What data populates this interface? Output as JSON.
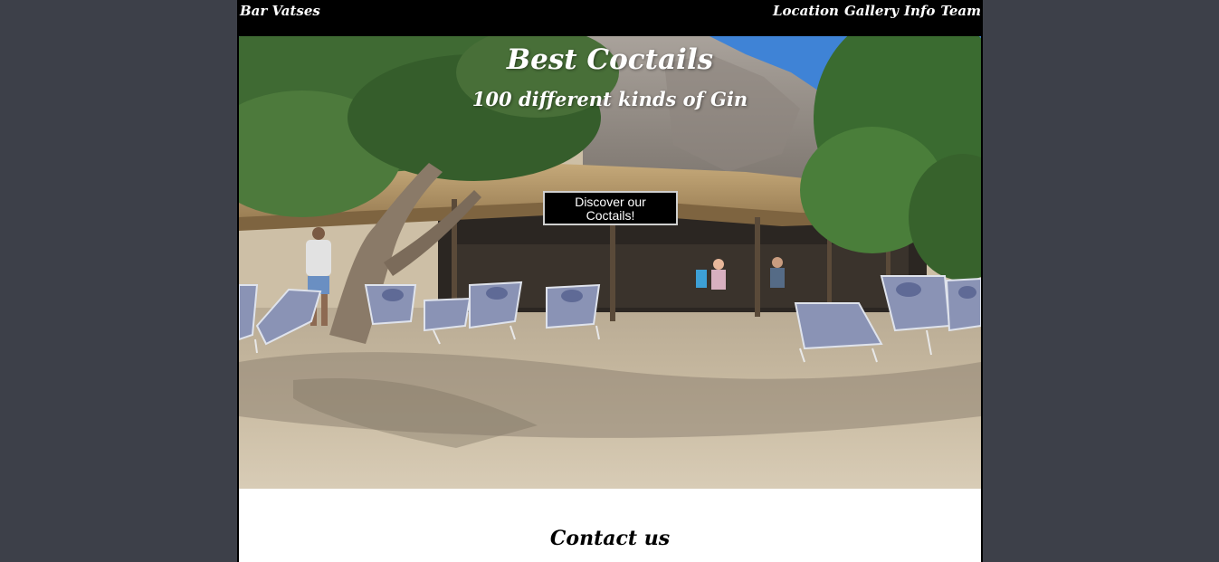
{
  "header": {
    "brand": "Bar Vatses",
    "nav": [
      "Location",
      "Gallery",
      "Info",
      "Team"
    ]
  },
  "hero": {
    "title": "Best Coctails",
    "subtitle": "100 different kinds of Gin",
    "cta_label": "Discover our Coctails!"
  },
  "contact": {
    "heading": "Contact us"
  },
  "colors": {
    "page_bg": "#3d4049",
    "header_bg": "#000000",
    "button_bg": "#000000",
    "sky": "#3a7fd4",
    "sand": "#cdbfa6"
  }
}
